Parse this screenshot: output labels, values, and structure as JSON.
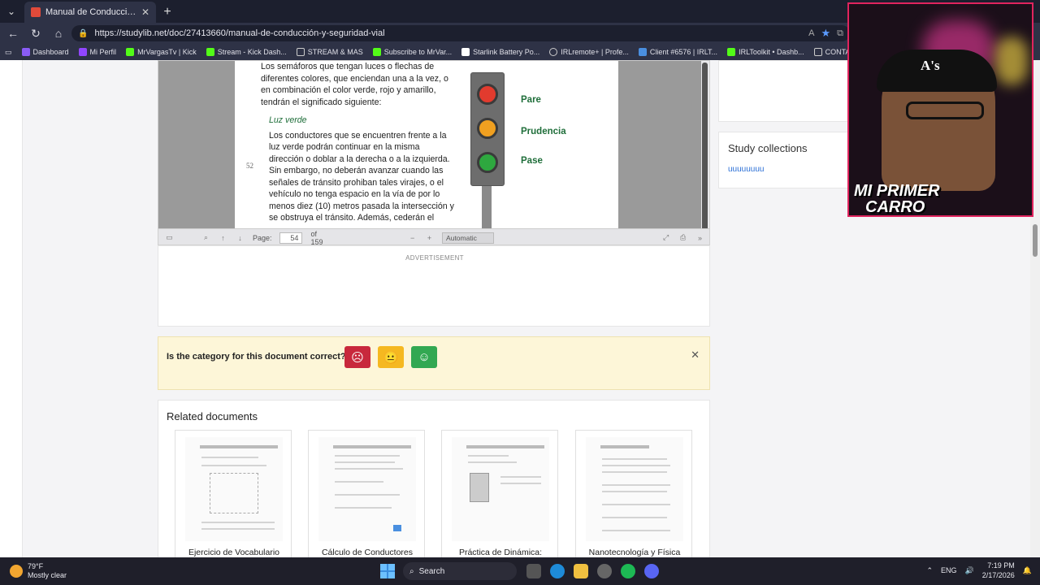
{
  "browser": {
    "tab_title": "Manual de Conducción y Segurida",
    "url": "https://studylib.net/doc/27413660/manual-de-conducción-y-seguridad-vial",
    "bookmarks": [
      {
        "label": "Dashboard",
        "color": "#8a5cf6"
      },
      {
        "label": "Mi Perfil",
        "color": "#9146ff"
      },
      {
        "label": "MrVargasTv | Kick",
        "color": "#53fc18"
      },
      {
        "label": "Stream - Kick Dash...",
        "color": "#53fc18"
      },
      {
        "label": "STREAM & MAS",
        "color": "#cccccc"
      },
      {
        "label": "Subscribe to MrVar...",
        "color": "#53fc18"
      },
      {
        "label": "Starlink Battery Po...",
        "color": "#ffffff"
      },
      {
        "label": "IRLremote+ | Profe...",
        "color": "#cccccc"
      },
      {
        "label": "Client #6576 | IRLT...",
        "color": "#4a8fe0"
      },
      {
        "label": "IRLToolkit • Dashb...",
        "color": "#53fc18"
      },
      {
        "label": "CONTADOR",
        "color": "#cccccc"
      }
    ]
  },
  "pdf": {
    "page_margin_number": "52",
    "paragraph1": "Los semáforos que tengan luces o flechas de diferentes colores, que enciendan una a la vez, o en combinación el color verde, rojo y amarillo, tendrán el significado siguiente:",
    "subheading": "Luz verde",
    "paragraph2": "Los conductores que se encuentren frente a la luz verde podrán continuar en la misma dirección o doblar a la derecha o a la izquierda. Sin embargo, no deberán avanzar cuando las señales de tránsito prohiban tales virajes, o el vehículo no tenga espacio en la vía de por lo menos diez (10) metros pasada la intersección y se obstruya el tránsito. Además, cederán el",
    "light_labels": {
      "red": "Pare",
      "yellow": "Prudencia",
      "green": "Pase"
    },
    "toolbar": {
      "page_label": "Page:",
      "page_value": "54",
      "page_total": "of 159",
      "zoom": "Automatic Zoom"
    }
  },
  "advertisement_label": "ADVERTISEMENT",
  "category_prompt": {
    "question": "Is the category for this document correct?"
  },
  "related": {
    "title": "Related documents",
    "cards": [
      {
        "caption": "Ejercicio de Vocabulario"
      },
      {
        "caption": "Cálculo de Conductores"
      },
      {
        "caption": "Práctica de Dinámica:"
      },
      {
        "caption": "Nanotecnología y Física"
      }
    ]
  },
  "sidebar": {
    "study_collections_title": "Study collections",
    "study_collections_link": "uuuuuuuu"
  },
  "webcam": {
    "banner_line1": "MI PRIMER",
    "banner_line2": "CARRO",
    "cap_logo": "A's"
  },
  "taskbar": {
    "temperature": "79°F",
    "weather": "Mostly clear",
    "search_placeholder": "Search",
    "language": "ENG",
    "time": "7:19 PM",
    "date": "2/17/2026"
  }
}
